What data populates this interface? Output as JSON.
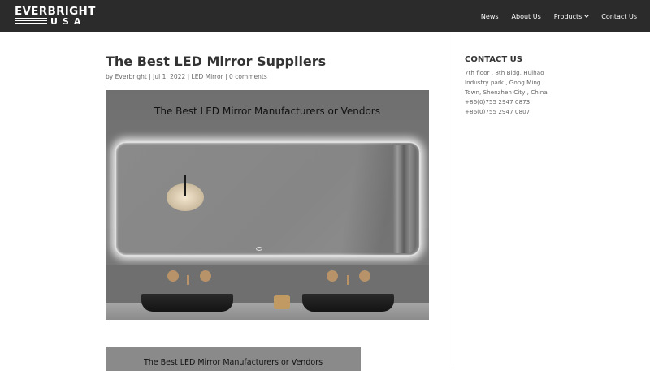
{
  "header": {
    "logo_top": "EVERBRIGHT",
    "logo_bottom": "USA",
    "nav": [
      {
        "label": "News"
      },
      {
        "label": "About Us"
      },
      {
        "label": "Products",
        "has_dropdown": true
      },
      {
        "label": "Contact Us"
      }
    ],
    "background": "#2b2b2b"
  },
  "post": {
    "title": "The Best LED Mirror Suppliers",
    "meta_by": "by",
    "author": "Everbright",
    "sep": "|",
    "date": "Jul 1, 2022",
    "category": "LED Mirror",
    "comments": "0 comments",
    "image_caption": "The Best LED Mirror Manufacturers or Vendors",
    "image2_caption": "The Best LED Mirror Manufacturers or Vendors"
  },
  "sidebar": {
    "title": "CONTACT US",
    "lines": [
      "7th floor , 8th Bldg, Huihao",
      "Industry park , Gong Ming",
      "Town, Shenzhen City , China",
      "+86(0)755 2947 0873",
      "+86(0)755 2947 0807"
    ]
  }
}
